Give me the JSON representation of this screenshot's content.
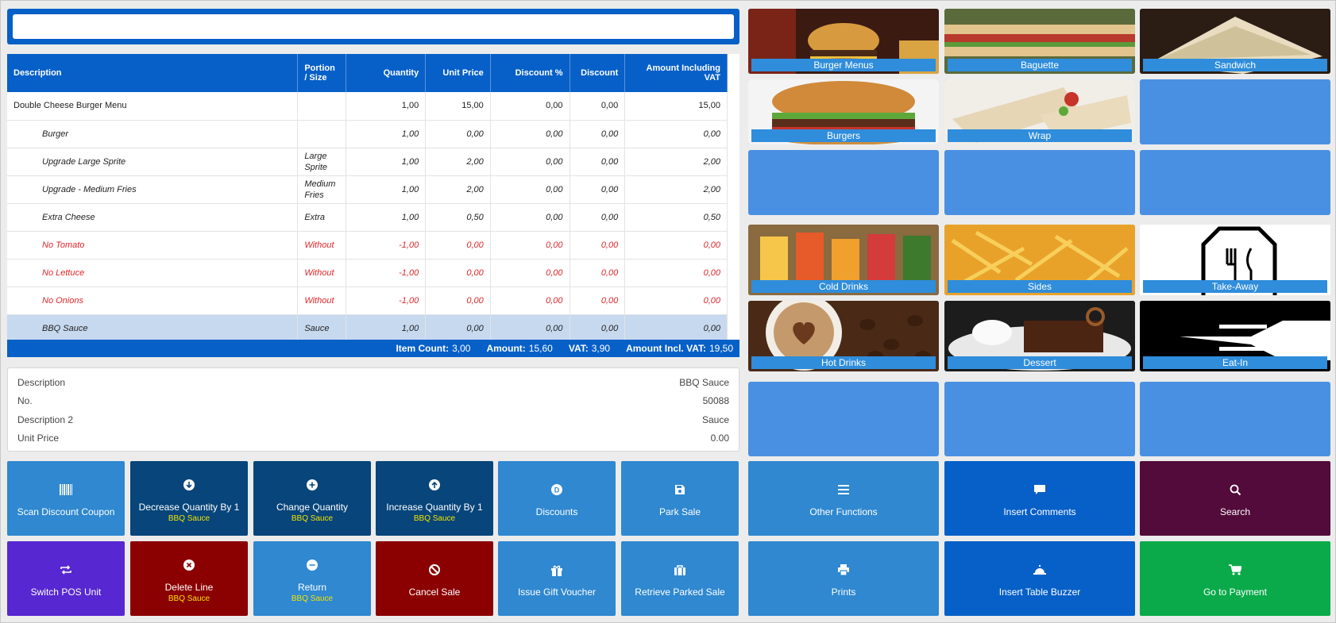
{
  "search": {
    "value": "",
    "placeholder": ""
  },
  "table": {
    "headers": [
      "Description",
      "Portion / Size",
      "Quantity",
      "Unit Price",
      "Discount %",
      "Discount",
      "Amount Including VAT"
    ],
    "rows": [
      {
        "description": "Double Cheese Burger Menu",
        "portion": "",
        "quantity": "1,00",
        "unit_price": "15,00",
        "discount_pct": "0,00",
        "discount": "0,00",
        "amount": "15,00"
      },
      {
        "description": "Burger",
        "portion": "",
        "quantity": "1,00",
        "unit_price": "0,00",
        "discount_pct": "0,00",
        "discount": "0,00",
        "amount": "0,00"
      },
      {
        "description": "Upgrade Large Sprite",
        "portion": "Large Sprite",
        "quantity": "1,00",
        "unit_price": "2,00",
        "discount_pct": "0,00",
        "discount": "0,00",
        "amount": "2,00"
      },
      {
        "description": "Upgrade - Medium Fries",
        "portion": "Medium Fries",
        "quantity": "1,00",
        "unit_price": "2,00",
        "discount_pct": "0,00",
        "discount": "0,00",
        "amount": "2,00"
      },
      {
        "description": "Extra Cheese",
        "portion": "Extra",
        "quantity": "1,00",
        "unit_price": "0,50",
        "discount_pct": "0,00",
        "discount": "0,00",
        "amount": "0,50"
      },
      {
        "description": "No Tomato",
        "portion": "Without",
        "quantity": "-1,00",
        "unit_price": "0,00",
        "discount_pct": "0,00",
        "discount": "0,00",
        "amount": "0,00"
      },
      {
        "description": "No Lettuce",
        "portion": "Without",
        "quantity": "-1,00",
        "unit_price": "0,00",
        "discount_pct": "0,00",
        "discount": "0,00",
        "amount": "0,00"
      },
      {
        "description": "No Onions",
        "portion": "Without",
        "quantity": "-1,00",
        "unit_price": "0,00",
        "discount_pct": "0,00",
        "discount": "0,00",
        "amount": "0,00"
      },
      {
        "description": "BBQ Sauce",
        "portion": "Sauce",
        "quantity": "1,00",
        "unit_price": "0,00",
        "discount_pct": "0,00",
        "discount": "0,00",
        "amount": "0,00"
      }
    ]
  },
  "totals": {
    "item_count_label": "Item Count:",
    "item_count": "3,00",
    "amount_label": "Amount:",
    "amount": "15,60",
    "vat_label": "VAT:",
    "vat": "3,90",
    "amount_incl_label": "Amount Incl. VAT:",
    "amount_incl": "19,50"
  },
  "details": {
    "description_label": "Description",
    "description_value": "BBQ Sauce",
    "no_label": "No.",
    "no_value": "50088",
    "description2_label": "Description 2",
    "description2_value": "Sauce",
    "unit_price_label": "Unit Price",
    "unit_price_value": "0.00"
  },
  "actions": {
    "scan_discount_coupon": "Scan Discount Coupon",
    "decrease_qty": "Decrease Quantity By 1",
    "decrease_qty_sub": "BBQ Sauce",
    "change_qty": "Change Quantity",
    "change_qty_sub": "BBQ Sauce",
    "increase_qty": "Increase Quantity By 1",
    "increase_qty_sub": "BBQ Sauce",
    "discounts": "Discounts",
    "park_sale": "Park Sale",
    "switch_pos_unit": "Switch POS Unit",
    "delete_line": "Delete Line",
    "delete_line_sub": "BBQ Sauce",
    "return": "Return",
    "return_sub": "BBQ Sauce",
    "cancel_sale": "Cancel Sale",
    "issue_gift_voucher": "Issue Gift Voucher",
    "retrieve_parked_sale": "Retrieve Parked Sale",
    "other_functions": "Other Functions",
    "insert_comments": "Insert Comments",
    "search": "Search",
    "prints": "Prints",
    "insert_table_buzzer": "Insert Table Buzzer",
    "go_to_payment": "Go to Payment"
  },
  "menu": {
    "burger_menus": "Burger Menus",
    "baguette": "Baguette",
    "sandwich": "Sandwich",
    "burgers": "Burgers",
    "wrap": "Wrap",
    "cold_drinks": "Cold Drinks",
    "sides": "Sides",
    "take_away": "Take-Away",
    "hot_drinks": "Hot Drinks",
    "dessert": "Dessert",
    "eat_in": "Eat-In"
  },
  "colors": {
    "primary_blue": "#0760c8",
    "button_light": "#2f88d0",
    "button_dark": "#07457a",
    "empty_tile": "#4a90e2",
    "purple": "#5727d1",
    "dark_red": "#8b0000",
    "maroon": "#520b3a",
    "green": "#0aaa4a",
    "highlight_yellow": "#f2e200",
    "negative_red": "#e0262b"
  }
}
